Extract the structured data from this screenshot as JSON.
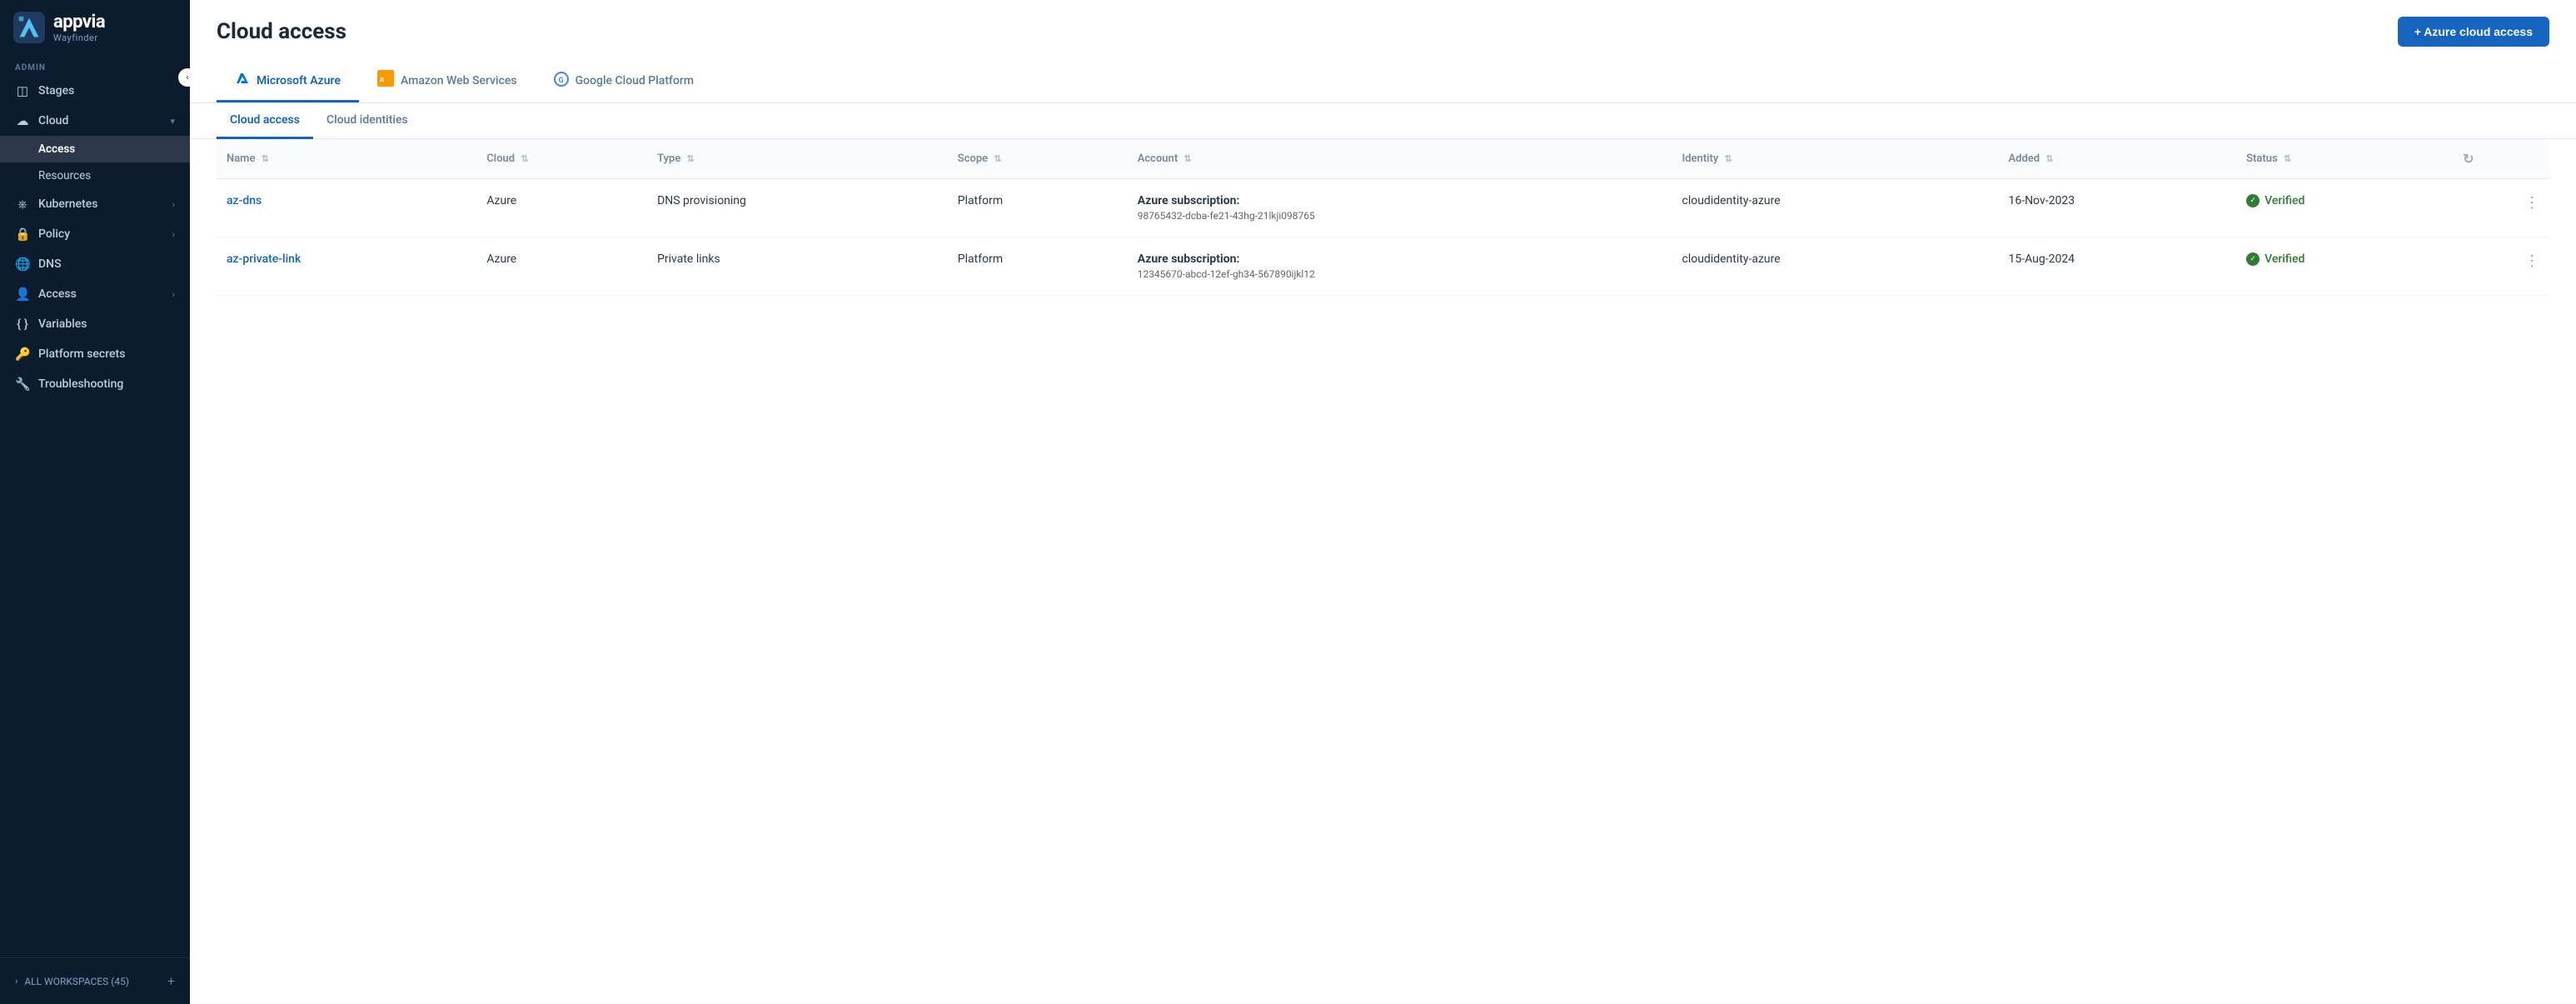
{
  "sidebar": {
    "brand": "appvia",
    "sub": "Wayfinder",
    "sections": [
      {
        "label": "ADMIN",
        "items": [
          {
            "id": "stages",
            "label": "Stages",
            "icon": "◫",
            "hasChildren": false
          },
          {
            "id": "cloud",
            "label": "Cloud",
            "icon": "☁",
            "hasChildren": true,
            "expanded": true,
            "children": [
              {
                "id": "access",
                "label": "Access",
                "active": true
              },
              {
                "id": "resources",
                "label": "Resources"
              }
            ]
          },
          {
            "id": "kubernetes",
            "label": "Kubernetes",
            "icon": "⎈",
            "hasChildren": true
          },
          {
            "id": "policy",
            "label": "Policy",
            "icon": "🔒",
            "hasChildren": true
          },
          {
            "id": "dns",
            "label": "DNS",
            "icon": "🌐"
          },
          {
            "id": "access-top",
            "label": "Access",
            "icon": "👤",
            "hasChildren": true
          },
          {
            "id": "variables",
            "label": "Variables",
            "icon": "{ }"
          },
          {
            "id": "platform-secrets",
            "label": "Platform secrets",
            "icon": "🔑"
          },
          {
            "id": "troubleshooting",
            "label": "Troubleshooting",
            "icon": "🔧"
          }
        ]
      }
    ],
    "all_workspaces": "ALL WORKSPACES (45)"
  },
  "header": {
    "title": "Cloud access",
    "add_button": "+ Azure cloud access"
  },
  "cloud_tabs": [
    {
      "id": "azure",
      "label": "Microsoft Azure",
      "active": true
    },
    {
      "id": "aws",
      "label": "Amazon Web Services",
      "active": false
    },
    {
      "id": "gcp",
      "label": "Google Cloud Platform",
      "active": false
    }
  ],
  "sub_tabs": [
    {
      "id": "cloud-access",
      "label": "Cloud access",
      "active": true
    },
    {
      "id": "cloud-identities",
      "label": "Cloud identities",
      "active": false
    }
  ],
  "table": {
    "columns": [
      {
        "id": "name",
        "label": "Name"
      },
      {
        "id": "cloud",
        "label": "Cloud"
      },
      {
        "id": "type",
        "label": "Type"
      },
      {
        "id": "scope",
        "label": "Scope"
      },
      {
        "id": "account",
        "label": "Account"
      },
      {
        "id": "identity",
        "label": "Identity"
      },
      {
        "id": "added",
        "label": "Added"
      },
      {
        "id": "status",
        "label": "Status"
      }
    ],
    "rows": [
      {
        "name": "az-dns",
        "cloud": "Azure",
        "type": "DNS provisioning",
        "scope": "Platform",
        "account_label": "Azure subscription:",
        "account_value": "98765432-dcba-fe21-43hg-21lkji098765",
        "identity": "cloudidentity-azure",
        "added": "16-Nov-2023",
        "status": "Verified"
      },
      {
        "name": "az-private-link",
        "cloud": "Azure",
        "type": "Private links",
        "scope": "Platform",
        "account_label": "Azure subscription:",
        "account_value": "12345670-abcd-12ef-gh34-567890ijkl12",
        "identity": "cloudidentity-azure",
        "added": "15-Aug-2024",
        "status": "Verified"
      }
    ]
  }
}
